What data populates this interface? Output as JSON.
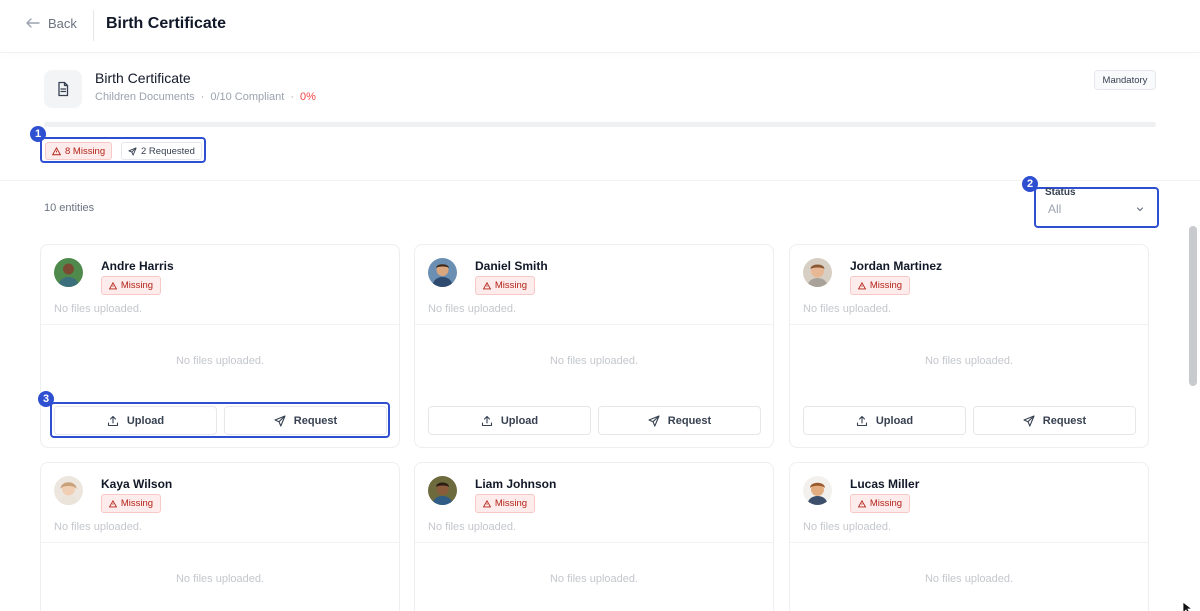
{
  "topbar": {
    "back_label": "Back",
    "title": "Birth Certificate"
  },
  "document": {
    "icon": "document-icon",
    "title": "Birth Certificate",
    "category": "Children Documents",
    "separator": "·",
    "compliance": "0/10 Compliant",
    "percent": "0%",
    "progress": 0,
    "badge": "Mandatory"
  },
  "summary": {
    "missing": "8 Missing",
    "requested": "2 Requested"
  },
  "list": {
    "entities_count": "10 entities"
  },
  "filter": {
    "label": "Status",
    "value": "All"
  },
  "markers": [
    "1",
    "2",
    "3"
  ],
  "colors": {
    "accent": "#2f4fd1",
    "missing_text": "#b42318",
    "missing_bg": "#fdeceb",
    "progress_fill": "#ef4444"
  },
  "cards": [
    {
      "name": "Andre Harris",
      "status": "Missing",
      "files_text": "No files uploaded.",
      "empty_text": "No files uploaded.",
      "upload_label": "Upload",
      "request_label": "Request"
    },
    {
      "name": "Daniel Smith",
      "status": "Missing",
      "files_text": "No files uploaded.",
      "empty_text": "No files uploaded.",
      "upload_label": "Upload",
      "request_label": "Request"
    },
    {
      "name": "Jordan Martinez",
      "status": "Missing",
      "files_text": "No files uploaded.",
      "empty_text": "No files uploaded.",
      "upload_label": "Upload",
      "request_label": "Request"
    },
    {
      "name": "Kaya Wilson",
      "status": "Missing",
      "files_text": "No files uploaded.",
      "empty_text": "No files uploaded."
    },
    {
      "name": "Liam Johnson",
      "status": "Missing",
      "files_text": "No files uploaded.",
      "empty_text": "No files uploaded."
    },
    {
      "name": "Lucas Miller",
      "status": "Missing",
      "files_text": "No files uploaded.",
      "empty_text": "No files uploaded."
    }
  ]
}
